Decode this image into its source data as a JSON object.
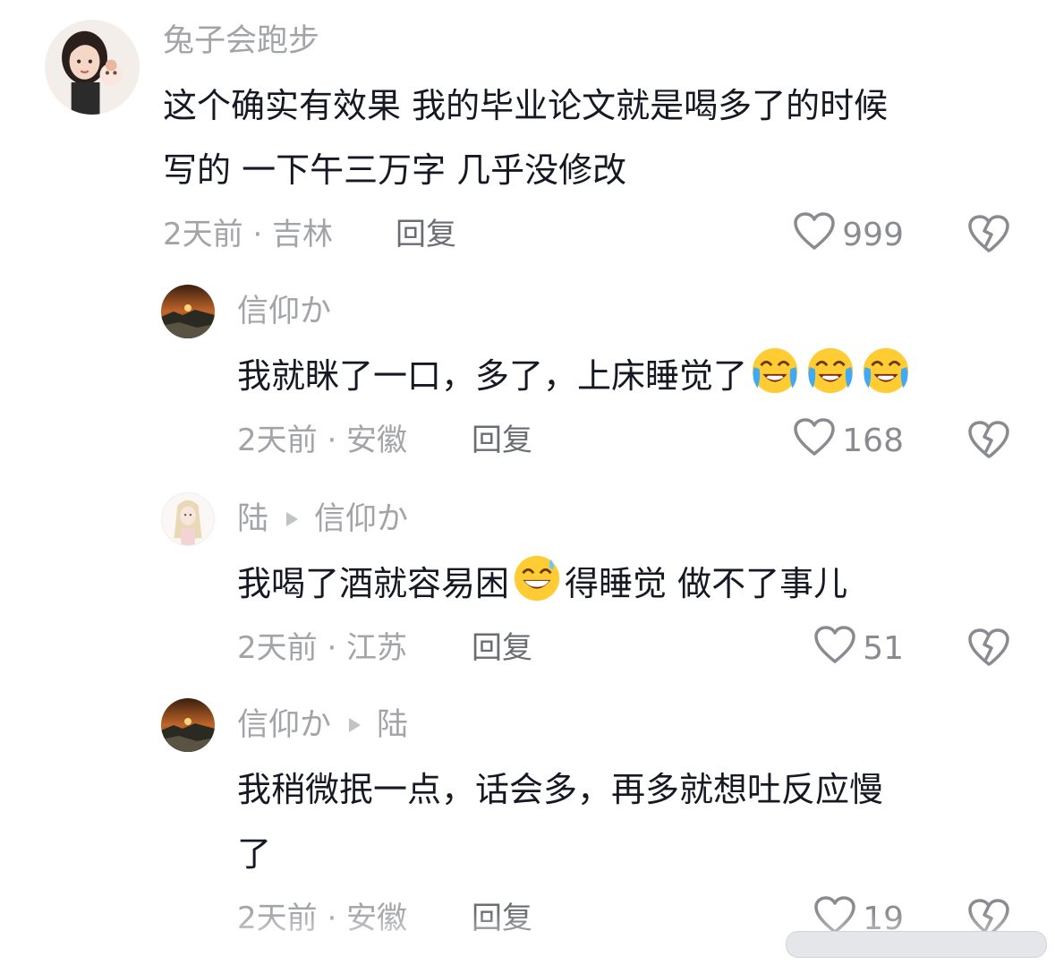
{
  "comments": [
    {
      "user": "兔子会跑步",
      "text_line1": "这个确实有效果 我的毕业论文就是喝多了的时候",
      "text_line2": "写的 一下午三万字 几乎没修改",
      "meta": "2天前 · 吉林",
      "reply_label": "回复",
      "likes": "999"
    },
    {
      "user": "信仰か",
      "text": "我就眯了一口，多了，上床睡觉了",
      "emojis": [
        "crying-laughing-emoji",
        "crying-laughing-emoji",
        "crying-laughing-emoji"
      ],
      "meta": "2天前 · 安徽",
      "reply_label": "回复",
      "likes": "168"
    },
    {
      "user": "陆",
      "reply_to": "信仰か",
      "text_before": "我喝了酒就容易困",
      "emoji": "grinning-sweat-emoji",
      "text_after": "得睡觉 做不了事儿",
      "meta": "2天前 · 江苏",
      "reply_label": "回复",
      "likes": "51"
    },
    {
      "user": "信仰か",
      "reply_to": "陆",
      "text_line1": "我稍微抿一点，话会多，再多就想吐反应慢",
      "text_line2": "了",
      "meta": "2天前 · 安徽",
      "reply_label": "回复",
      "likes": "19"
    }
  ],
  "colors": {
    "username": "#a3a4a8",
    "text": "#161823",
    "meta": "#a3a4a8",
    "reply": "#6b6d74",
    "icon": "#8a8b91"
  }
}
